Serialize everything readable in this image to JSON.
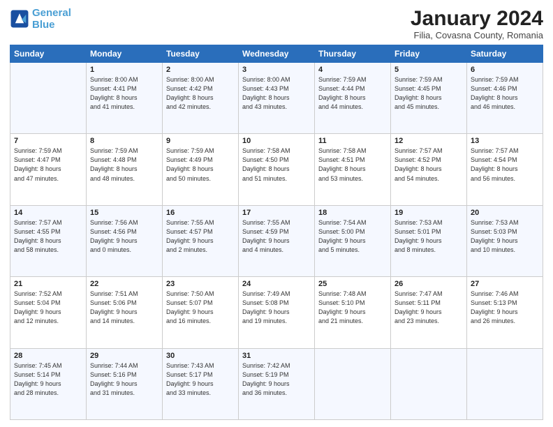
{
  "logo": {
    "text1": "General",
    "text2": "Blue"
  },
  "title": "January 2024",
  "subtitle": "Filia, Covasna County, Romania",
  "weekdays": [
    "Sunday",
    "Monday",
    "Tuesday",
    "Wednesday",
    "Thursday",
    "Friday",
    "Saturday"
  ],
  "weeks": [
    [
      {
        "day": "",
        "info": ""
      },
      {
        "day": "1",
        "info": "Sunrise: 8:00 AM\nSunset: 4:41 PM\nDaylight: 8 hours\nand 41 minutes."
      },
      {
        "day": "2",
        "info": "Sunrise: 8:00 AM\nSunset: 4:42 PM\nDaylight: 8 hours\nand 42 minutes."
      },
      {
        "day": "3",
        "info": "Sunrise: 8:00 AM\nSunset: 4:43 PM\nDaylight: 8 hours\nand 43 minutes."
      },
      {
        "day": "4",
        "info": "Sunrise: 7:59 AM\nSunset: 4:44 PM\nDaylight: 8 hours\nand 44 minutes."
      },
      {
        "day": "5",
        "info": "Sunrise: 7:59 AM\nSunset: 4:45 PM\nDaylight: 8 hours\nand 45 minutes."
      },
      {
        "day": "6",
        "info": "Sunrise: 7:59 AM\nSunset: 4:46 PM\nDaylight: 8 hours\nand 46 minutes."
      }
    ],
    [
      {
        "day": "7",
        "info": "Sunrise: 7:59 AM\nSunset: 4:47 PM\nDaylight: 8 hours\nand 47 minutes."
      },
      {
        "day": "8",
        "info": "Sunrise: 7:59 AM\nSunset: 4:48 PM\nDaylight: 8 hours\nand 48 minutes."
      },
      {
        "day": "9",
        "info": "Sunrise: 7:59 AM\nSunset: 4:49 PM\nDaylight: 8 hours\nand 50 minutes."
      },
      {
        "day": "10",
        "info": "Sunrise: 7:58 AM\nSunset: 4:50 PM\nDaylight: 8 hours\nand 51 minutes."
      },
      {
        "day": "11",
        "info": "Sunrise: 7:58 AM\nSunset: 4:51 PM\nDaylight: 8 hours\nand 53 minutes."
      },
      {
        "day": "12",
        "info": "Sunrise: 7:57 AM\nSunset: 4:52 PM\nDaylight: 8 hours\nand 54 minutes."
      },
      {
        "day": "13",
        "info": "Sunrise: 7:57 AM\nSunset: 4:54 PM\nDaylight: 8 hours\nand 56 minutes."
      }
    ],
    [
      {
        "day": "14",
        "info": "Sunrise: 7:57 AM\nSunset: 4:55 PM\nDaylight: 8 hours\nand 58 minutes."
      },
      {
        "day": "15",
        "info": "Sunrise: 7:56 AM\nSunset: 4:56 PM\nDaylight: 9 hours\nand 0 minutes."
      },
      {
        "day": "16",
        "info": "Sunrise: 7:55 AM\nSunset: 4:57 PM\nDaylight: 9 hours\nand 2 minutes."
      },
      {
        "day": "17",
        "info": "Sunrise: 7:55 AM\nSunset: 4:59 PM\nDaylight: 9 hours\nand 4 minutes."
      },
      {
        "day": "18",
        "info": "Sunrise: 7:54 AM\nSunset: 5:00 PM\nDaylight: 9 hours\nand 5 minutes."
      },
      {
        "day": "19",
        "info": "Sunrise: 7:53 AM\nSunset: 5:01 PM\nDaylight: 9 hours\nand 8 minutes."
      },
      {
        "day": "20",
        "info": "Sunrise: 7:53 AM\nSunset: 5:03 PM\nDaylight: 9 hours\nand 10 minutes."
      }
    ],
    [
      {
        "day": "21",
        "info": "Sunrise: 7:52 AM\nSunset: 5:04 PM\nDaylight: 9 hours\nand 12 minutes."
      },
      {
        "day": "22",
        "info": "Sunrise: 7:51 AM\nSunset: 5:06 PM\nDaylight: 9 hours\nand 14 minutes."
      },
      {
        "day": "23",
        "info": "Sunrise: 7:50 AM\nSunset: 5:07 PM\nDaylight: 9 hours\nand 16 minutes."
      },
      {
        "day": "24",
        "info": "Sunrise: 7:49 AM\nSunset: 5:08 PM\nDaylight: 9 hours\nand 19 minutes."
      },
      {
        "day": "25",
        "info": "Sunrise: 7:48 AM\nSunset: 5:10 PM\nDaylight: 9 hours\nand 21 minutes."
      },
      {
        "day": "26",
        "info": "Sunrise: 7:47 AM\nSunset: 5:11 PM\nDaylight: 9 hours\nand 23 minutes."
      },
      {
        "day": "27",
        "info": "Sunrise: 7:46 AM\nSunset: 5:13 PM\nDaylight: 9 hours\nand 26 minutes."
      }
    ],
    [
      {
        "day": "28",
        "info": "Sunrise: 7:45 AM\nSunset: 5:14 PM\nDaylight: 9 hours\nand 28 minutes."
      },
      {
        "day": "29",
        "info": "Sunrise: 7:44 AM\nSunset: 5:16 PM\nDaylight: 9 hours\nand 31 minutes."
      },
      {
        "day": "30",
        "info": "Sunrise: 7:43 AM\nSunset: 5:17 PM\nDaylight: 9 hours\nand 33 minutes."
      },
      {
        "day": "31",
        "info": "Sunrise: 7:42 AM\nSunset: 5:19 PM\nDaylight: 9 hours\nand 36 minutes."
      },
      {
        "day": "",
        "info": ""
      },
      {
        "day": "",
        "info": ""
      },
      {
        "day": "",
        "info": ""
      }
    ]
  ]
}
